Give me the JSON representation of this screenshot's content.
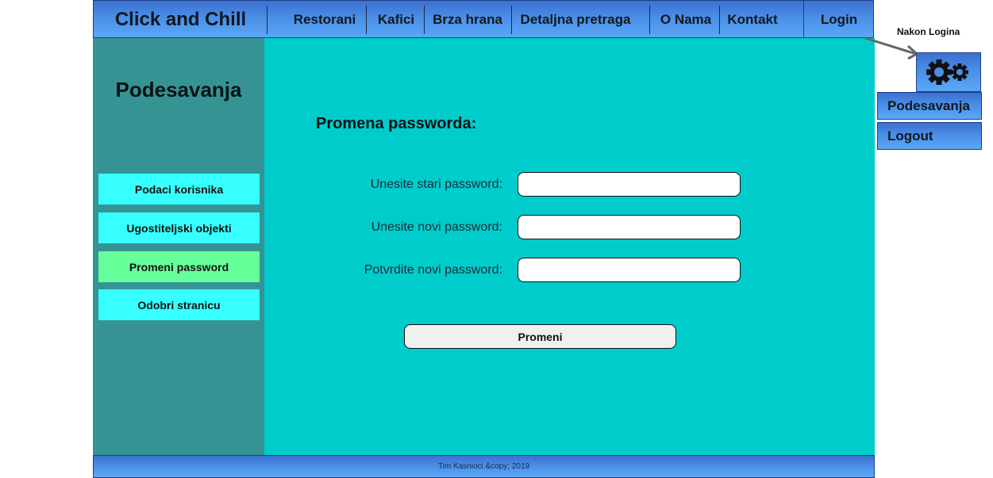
{
  "header": {
    "brand": "Click and Chill",
    "nav": [
      "Restorani",
      "Kafici",
      "Brza hrana",
      "Detaljna pretraga",
      "O Nama",
      "Kontakt"
    ],
    "login": "Login"
  },
  "sidebar": {
    "title": "Podesavanja",
    "items": [
      {
        "label": "Podaci korisnika"
      },
      {
        "label": "Ugostiteljski objekti"
      },
      {
        "label": "Promeni password"
      },
      {
        "label": "Odobri stranicu"
      }
    ],
    "active_item": "Promeni password"
  },
  "main": {
    "heading": "Promena passworda:",
    "fields": [
      {
        "label": "Unesite stari password:",
        "value": ""
      },
      {
        "label": "Unesite novi password:",
        "value": ""
      },
      {
        "label": "Potvrdite novi password:",
        "value": ""
      }
    ],
    "submit": "Promeni"
  },
  "footer": {
    "text": "Tim Kasnioci &copy; 2019"
  },
  "after_login": {
    "note": "Nakon Logina",
    "menu": [
      "Podesavanja",
      "Logout"
    ]
  },
  "colors": {
    "sidebar_bg": "#359394",
    "main_bg": "#00cccc",
    "sidebar_button": "#38ffff",
    "active_button": "#66ff99",
    "bar_gradient": [
      "#3b6fcf",
      "#5aa8f7"
    ]
  }
}
